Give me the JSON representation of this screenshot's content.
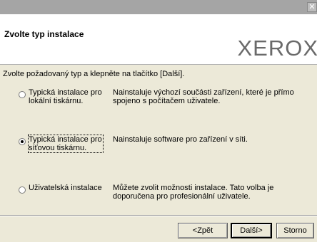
{
  "window": {
    "close_glyph": "✕"
  },
  "header": {
    "title": "Zvolte typ instalace",
    "brand": "XEROX"
  },
  "instruction": "Zvolte požadovaný typ a klepněte na tlačítko [Další].",
  "options": [
    {
      "label": "Typická instalace pro lokální tiskárnu.",
      "description": "Nainstaluje výchozí součásti zařízení, které je přímo spojeno s počítačem uživatele.",
      "selected": false
    },
    {
      "label": "Typická instalace pro síťovou tiskárnu.",
      "description": "Nainstaluje software pro zařízení v síti.",
      "selected": true
    },
    {
      "label": "Uživatelská instalace",
      "description": "Můžete zvolit možnosti instalace. Tato volba je doporučena pro profesionální uživatele.",
      "selected": false
    }
  ],
  "buttons": {
    "back": "<Zpět",
    "next": "Další>",
    "cancel": "Storno"
  }
}
